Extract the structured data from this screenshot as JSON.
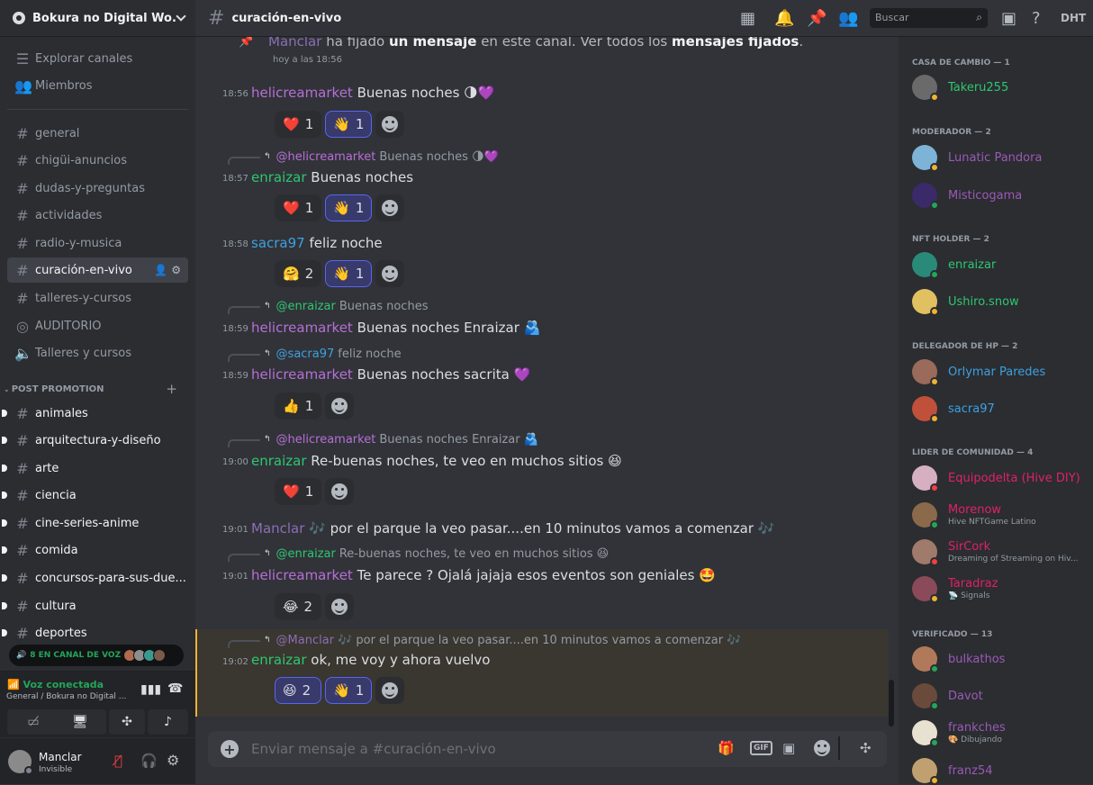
{
  "server": {
    "name": "Bokura no Digital Wo..."
  },
  "sidebar": {
    "top_items": [
      {
        "label": "Explorar canales",
        "icon": "explore-icon"
      },
      {
        "label": "Miembros",
        "icon": "members-icon"
      }
    ],
    "channels": [
      "general",
      "chigüi-anuncios",
      "dudas-y-preguntas",
      "actividades",
      "radio-y-musica",
      "curación-en-vivo",
      "talleres-y-cursos",
      "AUDITORIO",
      "Talleres y cursos"
    ],
    "category": "POST PROMOTION",
    "promo_channels": [
      "animales",
      "arquitectura-y-diseño",
      "arte",
      "ciencia",
      "cine-series-anime",
      "comida",
      "concursos-para-sus-due...",
      "cultura",
      "deportes"
    ],
    "voice_pill": "8 EN CANAL DE VOZ",
    "voice_connected": "Voz conectada",
    "voice_location": "General / Bokura no Digital ...",
    "user": {
      "name": "Manclar",
      "status": "Invisible"
    }
  },
  "header": {
    "channel": "curación-en-vivo",
    "search_placeholder": "Buscar",
    "dht": "DHT"
  },
  "pinned": {
    "actor": "Manclar",
    "t1": "ha fijado",
    "t2": "un mensaje",
    "t3": "en este canal. Ver todos los",
    "t4": "mensajes fijados",
    "t5": ".",
    "time": "hoy a las 18:56"
  },
  "messages": [
    {
      "time": "18:56",
      "author": "helicreamarket",
      "text": "Buenas noches 🌗💜",
      "reactions": [
        {
          "emoji": "❤️",
          "count": "1"
        },
        {
          "emoji": "👋",
          "count": "1",
          "me": true
        }
      ]
    },
    {
      "time": "18:57",
      "author": "enraizar",
      "reply_to": "@helicreamarket",
      "reply_text": "Buenas noches 🌗💜",
      "text": "Buenas noches",
      "reactions": [
        {
          "emoji": "❤️",
          "count": "1"
        },
        {
          "emoji": "👋",
          "count": "1",
          "me": true
        }
      ]
    },
    {
      "time": "18:58",
      "author": "sacra97",
      "text": "feliz noche",
      "reactions": [
        {
          "emoji": "🤗",
          "count": "2"
        },
        {
          "emoji": "👋",
          "count": "1",
          "me": true
        }
      ]
    },
    {
      "time": "18:59",
      "author": "helicreamarket",
      "reply_to": "@enraizar",
      "reply_text": "Buenas noches",
      "text": "Buenas noches Enraizar 🫂"
    },
    {
      "time": "18:59",
      "author": "helicreamarket",
      "reply_to": "@sacra97",
      "reply_text": "feliz noche",
      "text": "Buenas noches sacrita 💜",
      "reactions": [
        {
          "emoji": "👍",
          "count": "1"
        }
      ]
    },
    {
      "time": "19:00",
      "author": "enraizar",
      "reply_to": "@helicreamarket",
      "reply_text": "Buenas noches Enraizar 🫂",
      "text": "Re-buenas noches, te veo en muchos sitios 😆",
      "reactions": [
        {
          "emoji": "❤️",
          "count": "1"
        }
      ]
    },
    {
      "time": "19:01",
      "author": "Manclar",
      "text": "🎶 por el parque la veo pasar....en 10 minutos vamos a comenzar 🎶"
    },
    {
      "time": "19:01",
      "author": "helicreamarket",
      "reply_to": "@enraizar",
      "reply_text": "Re-buenas noches, te veo en muchos sitios 😆",
      "text": "Te parece ? Ojalá jajaja esos eventos son geniales 🤩",
      "reactions": [
        {
          "emoji": "😂",
          "count": "2"
        }
      ]
    },
    {
      "time": "19:02",
      "author": "enraizar",
      "reply_to": "@Manclar",
      "reply_text": "🎶 por el parque la veo pasar....en 10 minutos vamos a comenzar 🎶",
      "text": "ok, me voy y ahora vuelvo",
      "reactions": [
        {
          "emoji": "😆",
          "count": "2",
          "me": true
        },
        {
          "emoji": "👋",
          "count": "1",
          "me": true
        }
      ]
    }
  ],
  "input": {
    "placeholder": "Enviar mensaje a #curación-en-vivo",
    "gif": "GIF"
  },
  "members": {
    "groups": [
      {
        "title": "CASA DE CAMBIO — 1",
        "members": [
          {
            "name": "Takeru255"
          }
        ]
      },
      {
        "title": "MODERADOR — 2",
        "members": [
          {
            "name": "Lunatic Pandora"
          },
          {
            "name": "Misticogama"
          }
        ]
      },
      {
        "title": "NFT HOLDER — 2",
        "members": [
          {
            "name": "enraizar"
          },
          {
            "name": "Ushiro.snow"
          }
        ]
      },
      {
        "title": "DELEGADOR DE HP — 2",
        "members": [
          {
            "name": "Orlymar Paredes"
          },
          {
            "name": "sacra97"
          }
        ]
      },
      {
        "title": "LIDER DE COMUNIDAD — 4",
        "members": [
          {
            "name": "Equipodelta (Hive DIY)"
          },
          {
            "name": "Morenow",
            "status": "Hive NFTGame Latino"
          },
          {
            "name": "SirCork",
            "status": "Dreaming of Streaming on Hiv..."
          },
          {
            "name": "Taradraz",
            "status": "📡 Signals"
          }
        ]
      },
      {
        "title": "VERIFICADO — 13",
        "members": [
          {
            "name": "bulkathos"
          },
          {
            "name": "Davot"
          },
          {
            "name": "frankches",
            "status": "🎨 Dibujando"
          },
          {
            "name": "franz54"
          }
        ]
      }
    ]
  },
  "colors": {
    "enraizar": "#2dc770",
    "helicreamarket": "#b76fd6",
    "sacra97": "#3ea0e0",
    "Manclar": "#8a6fb5",
    "mod": "#9b59b6",
    "online": "#23a55a",
    "idle": "#f0b232",
    "dnd": "#f23f43"
  }
}
